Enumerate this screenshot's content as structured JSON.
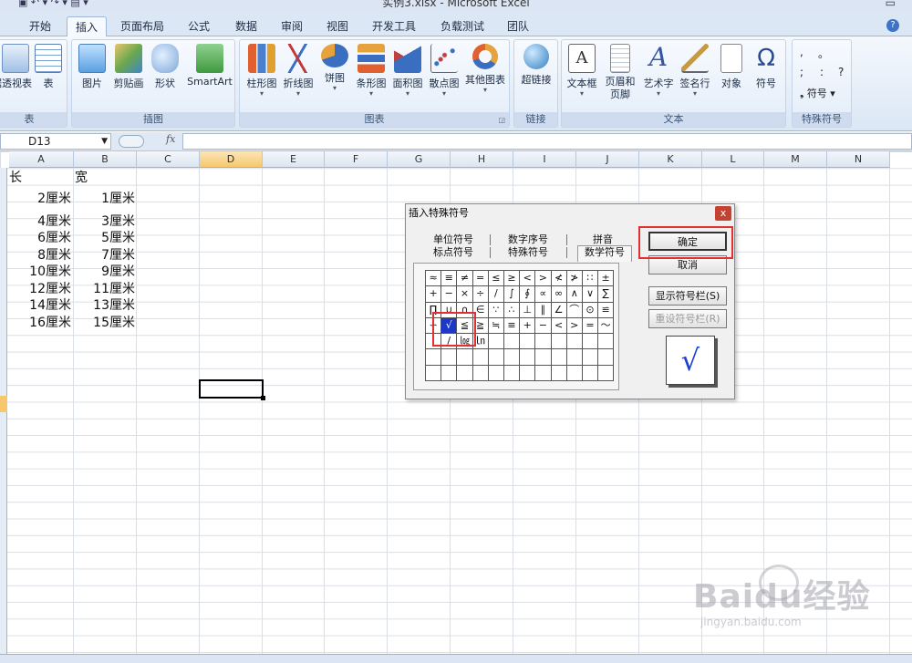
{
  "window": {
    "title": "实例3.xlsx - Microsoft Excel"
  },
  "ribbon": {
    "tabs": [
      "开始",
      "插入",
      "页面布局",
      "公式",
      "数据",
      "审阅",
      "视图",
      "开发工具",
      "负载测试",
      "团队"
    ],
    "active_tab": "插入",
    "groups": {
      "table": {
        "label": "表",
        "buttons": [
          "数据透视表",
          "表"
        ]
      },
      "illustrations": {
        "label": "插图",
        "buttons": [
          "图片",
          "剪贴画",
          "形状",
          "SmartArt"
        ]
      },
      "charts": {
        "label": "图表",
        "buttons": [
          "柱形图",
          "折线图",
          "饼图",
          "条形图",
          "面积图",
          "散点图",
          "其他图表"
        ]
      },
      "links": {
        "label": "链接",
        "buttons": [
          "超链接"
        ]
      },
      "text": {
        "label": "文本",
        "buttons": [
          "文本框",
          "页眉和页脚",
          "艺术字",
          "签名行",
          "对象",
          "符号"
        ]
      },
      "special_symbols": {
        "label": "特殊符号",
        "symbols": [
          ",",
          "。",
          ";",
          ":",
          "?"
        ],
        "dropdown": "符号"
      }
    }
  },
  "formula_bar": {
    "name_box": "D13",
    "fx_label": "fx",
    "value": ""
  },
  "sheet": {
    "columns": [
      "A",
      "B",
      "C",
      "D",
      "E",
      "F",
      "G",
      "H",
      "I",
      "J",
      "K",
      "L",
      "M",
      "N"
    ],
    "selected_column": "D",
    "headers": {
      "A": "长",
      "B": "宽"
    },
    "rows": [
      {
        "a": "2厘米",
        "b": "1厘米"
      },
      {
        "a": "4厘米",
        "b": "3厘米"
      },
      {
        "a": "6厘米",
        "b": "5厘米"
      },
      {
        "a": "8厘米",
        "b": "7厘米"
      },
      {
        "a": "10厘米",
        "b": "9厘米"
      },
      {
        "a": "12厘米",
        "b": "11厘米"
      },
      {
        "a": "14厘米",
        "b": "13厘米"
      },
      {
        "a": "16厘米",
        "b": "15厘米"
      }
    ]
  },
  "dialog": {
    "title": "插入特殊符号",
    "close_label": "x",
    "tabs_row1": [
      "单位符号",
      "数字序号",
      "拼音"
    ],
    "tabs_row2": [
      "标点符号",
      "特殊符号",
      "数学符号"
    ],
    "active_tab": "数学符号",
    "symbols": [
      [
        "≈",
        "≡",
        "≠",
        "=",
        "≤",
        "≥",
        "<",
        ">",
        "≮",
        "≯",
        "∷",
        "±"
      ],
      [
        "+",
        "−",
        "×",
        "÷",
        "/",
        "∫",
        "∮",
        "∝",
        "∞",
        "∧",
        "∨",
        "∑"
      ],
      [
        "∏",
        "∪",
        "∩",
        "∈",
        "∵",
        "∴",
        "⊥",
        "∥",
        "∠",
        "⌒",
        "⊙",
        "≌"
      ],
      [
        "∽",
        "√",
        "≦",
        "≧",
        "≒",
        "≡",
        "+",
        "−",
        "<",
        ">",
        "=",
        "～"
      ],
      [
        "|",
        "/",
        "㏒",
        "㏑",
        "",
        "",
        "",
        "",
        "",
        "",
        "",
        ""
      ],
      [
        "",
        "",
        "",
        "",
        "",
        "",
        "",
        "",
        "",
        "",
        "",
        ""
      ],
      [
        "",
        "",
        "",
        "",
        "",
        "",
        "",
        "",
        "",
        "",
        "",
        ""
      ]
    ],
    "selected_symbol": "√",
    "buttons": {
      "ok": "确定",
      "cancel": "取消",
      "show_bar": "显示符号栏(S)",
      "reset_bar": "重设符号栏(R)"
    },
    "preview": "√"
  },
  "colors": {
    "annotation": "#e03030",
    "selected_symbol_bg": "#1c38c8",
    "preview_glyph": "#1b3fd0"
  },
  "watermark": {
    "logo": "Baidu经验",
    "url": "jingyan.baidu.com"
  }
}
